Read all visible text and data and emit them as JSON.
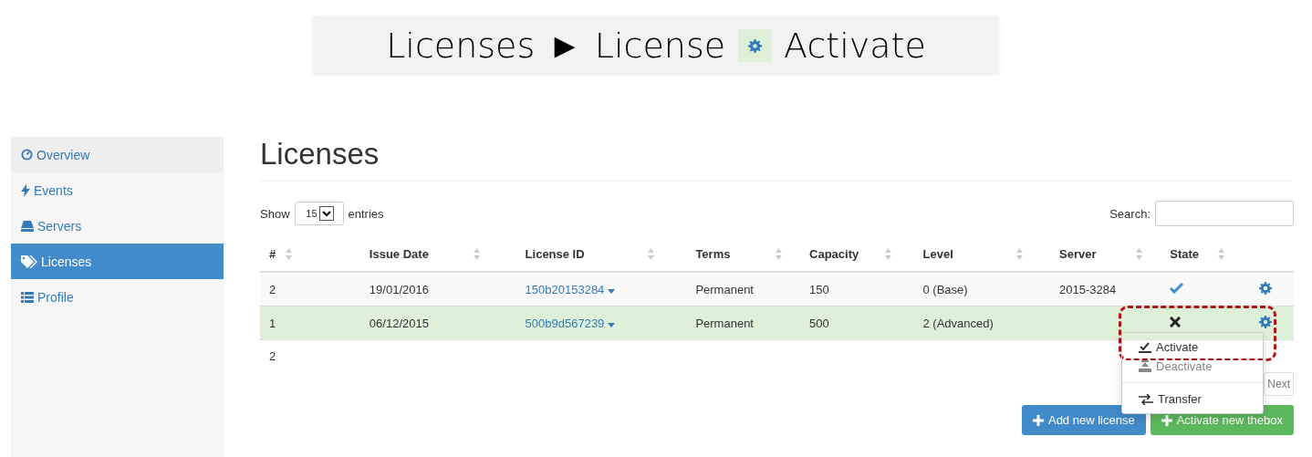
{
  "caption": {
    "parts": [
      "Licenses",
      "►",
      "License",
      "Activate"
    ]
  },
  "sidebar": {
    "items": [
      {
        "label": "Overview",
        "selected": false
      },
      {
        "label": "Events",
        "selected": false
      },
      {
        "label": "Servers",
        "selected": false
      },
      {
        "label": "Licenses",
        "selected": true
      },
      {
        "label": "Profile",
        "selected": false
      }
    ]
  },
  "page": {
    "title": "Licenses"
  },
  "length": {
    "prefix": "Show",
    "value": "15",
    "suffix": "entries"
  },
  "search": {
    "label": "Search:"
  },
  "table": {
    "columns": [
      "#",
      "Issue Date",
      "License ID",
      "Terms",
      "Capacity",
      "Level",
      "Server",
      "State"
    ],
    "rows": [
      {
        "cells": [
          "2",
          "19/01/2016",
          "150b20153284",
          "Permanent",
          "150",
          "0 (Base)",
          "2015-3284"
        ],
        "active": true,
        "selected": false
      },
      {
        "cells": [
          "1",
          "06/12/2015",
          "500b9d567239",
          "Permanent",
          "500",
          "2 (Advanced)",
          ""
        ],
        "active": false,
        "selected": true
      }
    ]
  },
  "info": "2",
  "pager": {
    "next": "Next"
  },
  "menu": {
    "items": [
      {
        "kind": "item",
        "label": "Activate",
        "disabled": false
      },
      {
        "kind": "item",
        "label": "Deactivate",
        "disabled": true
      },
      {
        "kind": "divider"
      },
      {
        "kind": "item",
        "label": "Transfer",
        "disabled": false
      }
    ]
  },
  "buttons": [
    {
      "label": "Add new license",
      "kind": "primary"
    },
    {
      "label": "Activate new thebox",
      "kind": "success"
    }
  ]
}
